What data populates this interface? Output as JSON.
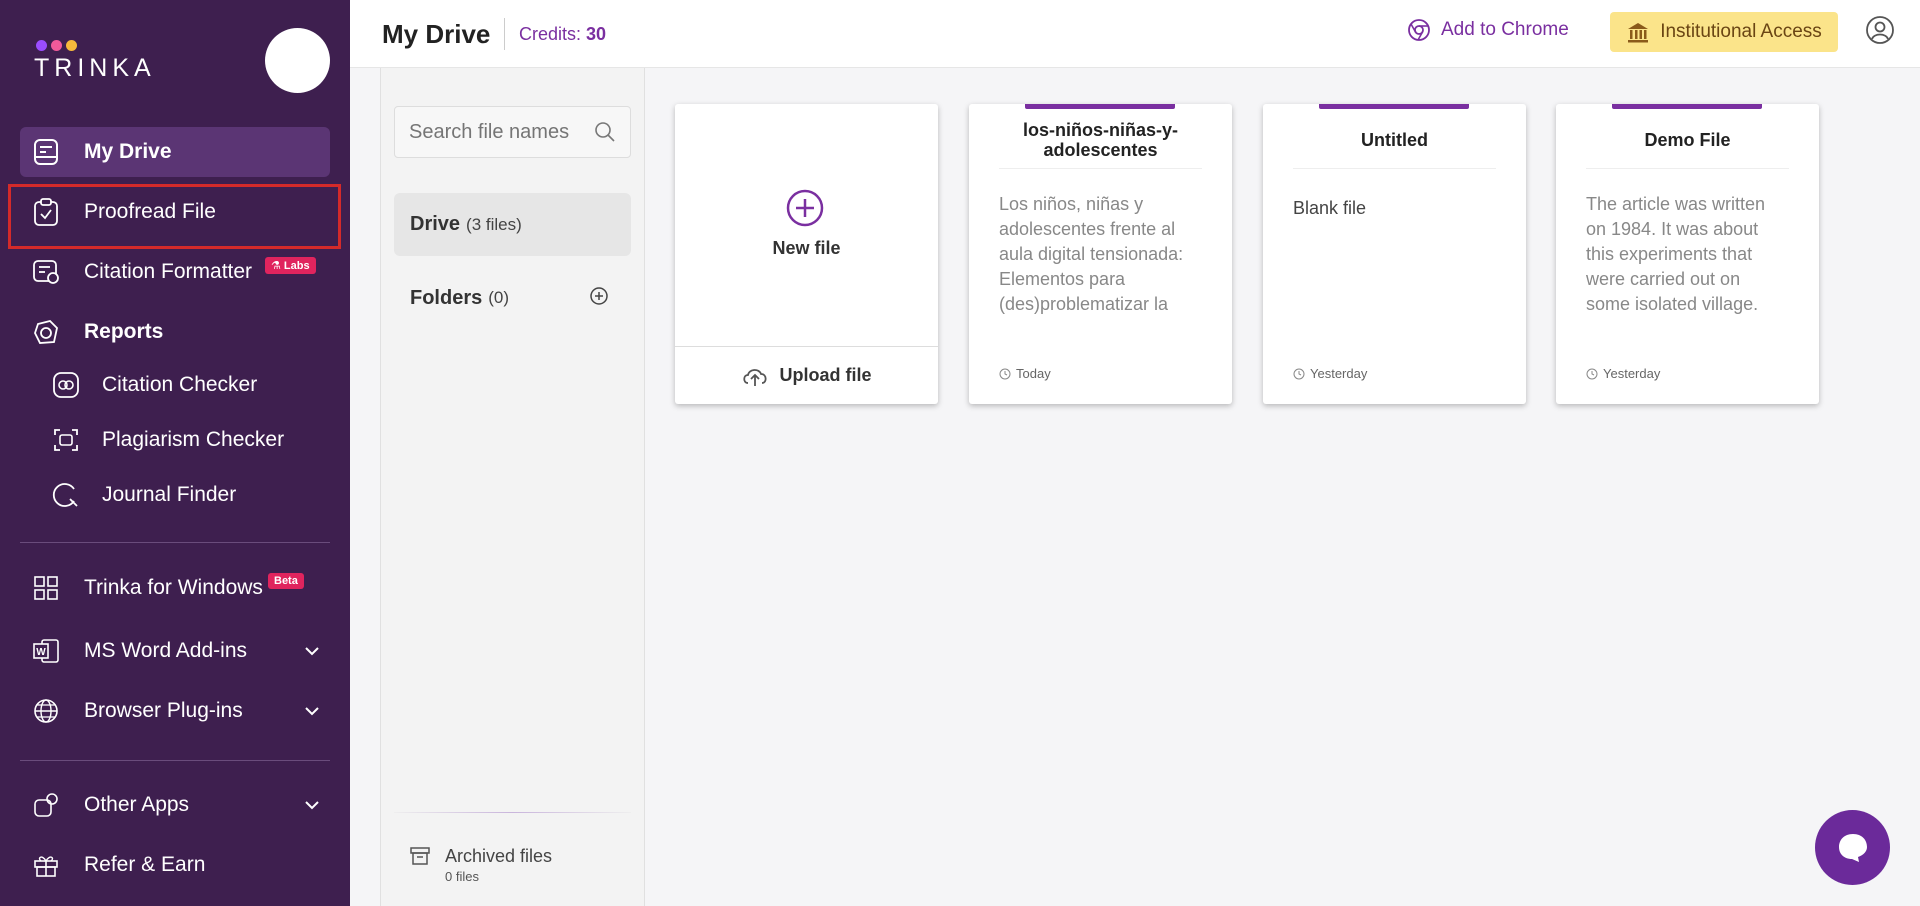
{
  "brand": {
    "name": "TRINKA",
    "dot_colors": [
      "#9b4dff",
      "#f15a9a",
      "#f6b93b"
    ]
  },
  "sidebar": {
    "items": [
      {
        "label": "My Drive",
        "icon": "drive-icon"
      },
      {
        "label": "Proofread File",
        "icon": "clipboard-check-icon"
      },
      {
        "label": "Citation Formatter",
        "icon": "citation-formatter-icon",
        "badge": "Labs"
      },
      {
        "label": "Reports",
        "icon": "reports-icon"
      },
      {
        "label": "Citation Checker",
        "icon": "citation-checker-icon"
      },
      {
        "label": "Plagiarism Checker",
        "icon": "plagiarism-icon"
      },
      {
        "label": "Journal Finder",
        "icon": "journal-finder-icon"
      },
      {
        "label": "Trinka for Windows",
        "icon": "windows-icon",
        "badge": "Beta"
      },
      {
        "label": "MS Word Add-ins",
        "icon": "word-icon"
      },
      {
        "label": "Browser Plug-ins",
        "icon": "globe-icon"
      },
      {
        "label": "Other Apps",
        "icon": "apps-icon"
      },
      {
        "label": "Refer & Earn",
        "icon": "gift-icon"
      }
    ]
  },
  "header": {
    "title": "My Drive",
    "credits_label": "Credits:",
    "credits_value": "30",
    "add_to_chrome": "Add to Chrome",
    "institutional_access": "Institutional Access"
  },
  "panel": {
    "search_placeholder": "Search file names",
    "drive_label": "Drive",
    "drive_count": "(3 files)",
    "folders_label": "Folders",
    "folders_count": "(0)",
    "archived_label": "Archived files",
    "archived_count": "0 files"
  },
  "new_card": {
    "label": "New file",
    "upload": "Upload file"
  },
  "files": [
    {
      "title": "los-niños-niñas-y-adolescentes",
      "preview": "Los niños, niñas y adolescentes frente al aula digital tensionada: Elementos para (des)problematizar la escuela Resumen El",
      "date": "Today"
    },
    {
      "title": "Untitled",
      "preview": "Blank file",
      "date": "Yesterday"
    },
    {
      "title": "Demo File",
      "preview": "The article was written on 1984. It was about this experiments that were carried out on some isolated village. The villages (Lulbushki)",
      "date": "Yesterday"
    }
  ],
  "colors": {
    "sidebar_bg": "#3e1f4f",
    "accent": "#7a2fa0",
    "institutional_bg": "#fbe48a",
    "highlight": "#d42a2a"
  }
}
